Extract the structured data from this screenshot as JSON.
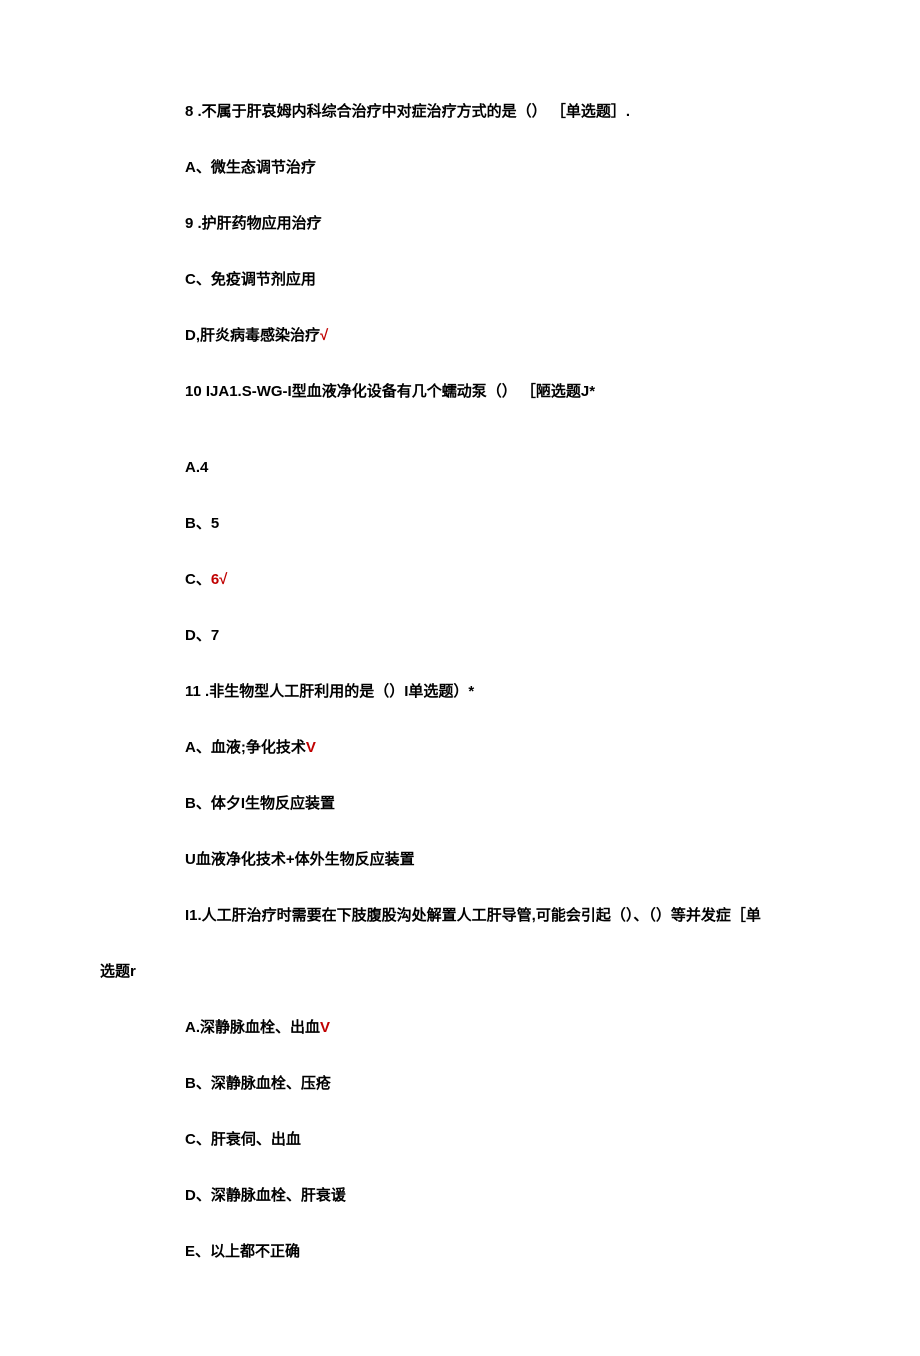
{
  "questions": [
    {
      "number": "8",
      "stem": " .不属于肝哀姆内科综合治疗中对症治疗方式的是（） ［单选题］.",
      "options": [
        {
          "label": "A、微生态调节治疗",
          "correct": false
        },
        {
          "label": "9 .护肝药物应用治疗",
          "correct": false
        },
        {
          "label": "C、免疫调节剂应用",
          "correct": false
        },
        {
          "label": "D,肝炎病毒感染治疗",
          "mark": "√",
          "correct": true
        }
      ]
    },
    {
      "number": "10",
      "stem": "  IJA1.S-WG-I型血液净化设备有几个蠕动泵（） ［陋选题J*",
      "options": [
        {
          "label": "A.4",
          "correct": false
        },
        {
          "label": "B、5",
          "correct": false
        },
        {
          "label": "C、",
          "value": "6√",
          "correct": true
        },
        {
          "label": "D、7",
          "correct": false
        }
      ]
    },
    {
      "number": "11",
      "stem": " .非生物型人工肝利用的是（）I单选题）*",
      "options": [
        {
          "label": "A、血液;争化技术",
          "mark": "V",
          "correct": true
        },
        {
          "label": "B、体夕I生物反应装置",
          "correct": false
        },
        {
          "label": "U血液净化技术+体外生物反应装置",
          "correct": false
        }
      ]
    },
    {
      "number": "I1",
      "stem_part1": ".人工肝治疗时需要在下肢腹股沟处解置人工肝导管,可能会引起（）、（）等并发症［单",
      "stem_part2": "选题r",
      "options": [
        {
          "label": "A.深静脉血栓、出血",
          "mark": "V",
          "correct": true
        },
        {
          "label": "B、深静脉血栓、压疮",
          "correct": false
        },
        {
          "label": "C、肝衰伺、出血",
          "correct": false
        },
        {
          "label": "D、深静脉血栓、肝衰谖",
          "correct": false
        },
        {
          "label": "E、以上都不正确",
          "correct": false
        }
      ]
    }
  ]
}
